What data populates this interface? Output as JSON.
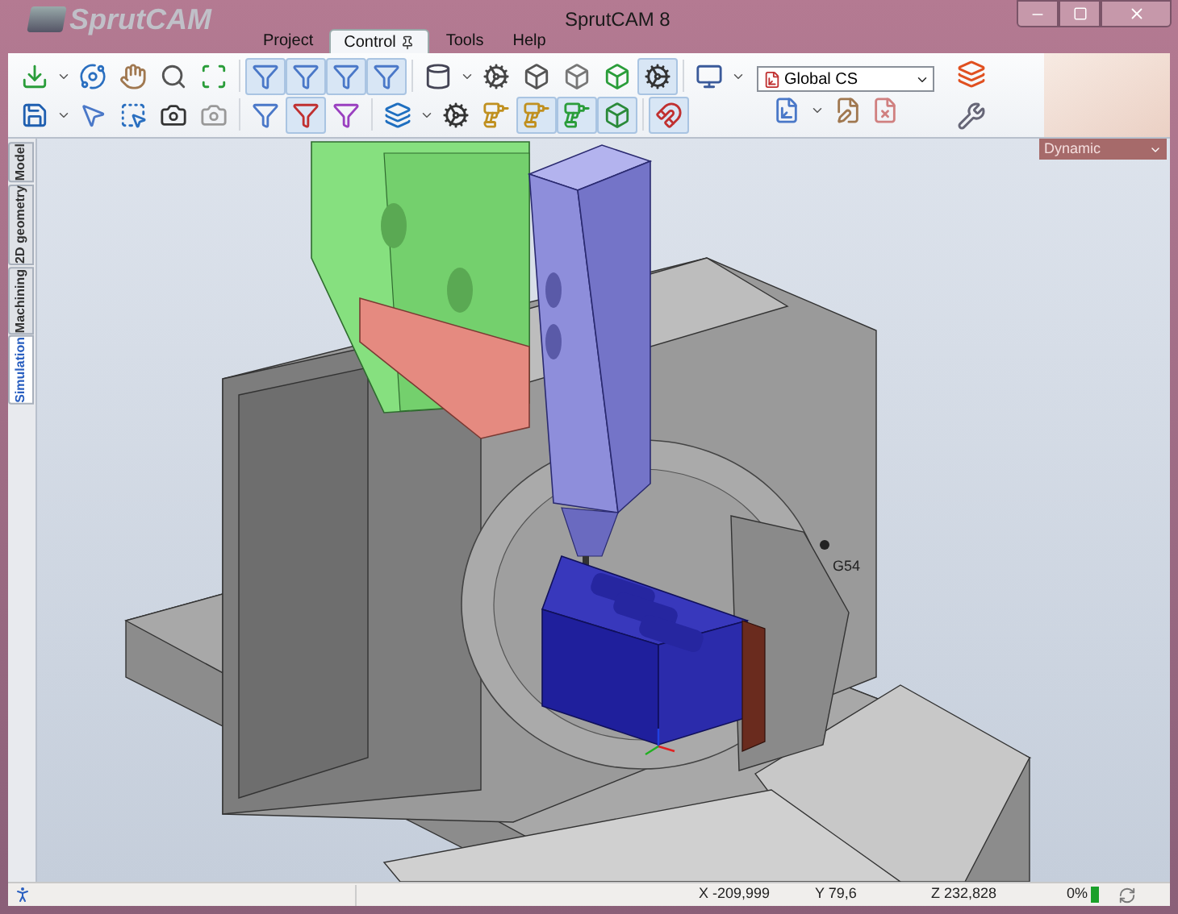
{
  "window": {
    "logo": "SprutCAM",
    "title": "SprutCAM 8"
  },
  "menu_tabs": [
    {
      "label": "Project",
      "selected": false,
      "pinned": false
    },
    {
      "label": "Control",
      "selected": true,
      "pinned": true
    },
    {
      "label": "Tools",
      "selected": false,
      "pinned": false
    },
    {
      "label": "Help",
      "selected": false,
      "pinned": false
    }
  ],
  "toolbar": {
    "row_1": [
      {
        "selected": false
      },
      {
        "selected": false
      },
      {
        "selected": false
      },
      {
        "selected": false
      },
      {
        "selected": false
      },
      {
        "selected": true
      },
      {
        "selected": true
      },
      {
        "selected": true
      },
      {
        "selected": true
      },
      {
        "selected": false
      },
      {
        "selected": false
      },
      {
        "selected": false
      },
      {
        "selected": false
      },
      {
        "selected": false
      },
      {
        "selected": true
      },
      {
        "selected": false
      }
    ],
    "row_2": [
      {
        "selected": false
      },
      {
        "selected": false
      },
      {
        "selected": false
      },
      {
        "selected": false
      },
      {
        "selected": false
      },
      {
        "selected": false
      },
      {
        "selected": true
      },
      {
        "selected": false
      },
      {
        "selected": false
      },
      {
        "selected": false
      },
      {
        "selected": false
      },
      {
        "selected": true
      },
      {
        "selected": true
      },
      {
        "selected": true
      },
      {
        "selected": true
      }
    ],
    "coordinate_system": "Global CS"
  },
  "view_mode": "Dynamic",
  "side_tabs": [
    {
      "label": "Model",
      "selected": false
    },
    {
      "label": "2D geometry",
      "selected": false
    },
    {
      "label": "Machining",
      "selected": false
    },
    {
      "label": "Simulation",
      "selected": true
    }
  ],
  "viewport": {
    "origin_label": "G54"
  },
  "status_bar": {
    "x": "X -209,999",
    "y": "Y 79,6",
    "z": "Z 232,828",
    "progress": "0%"
  }
}
